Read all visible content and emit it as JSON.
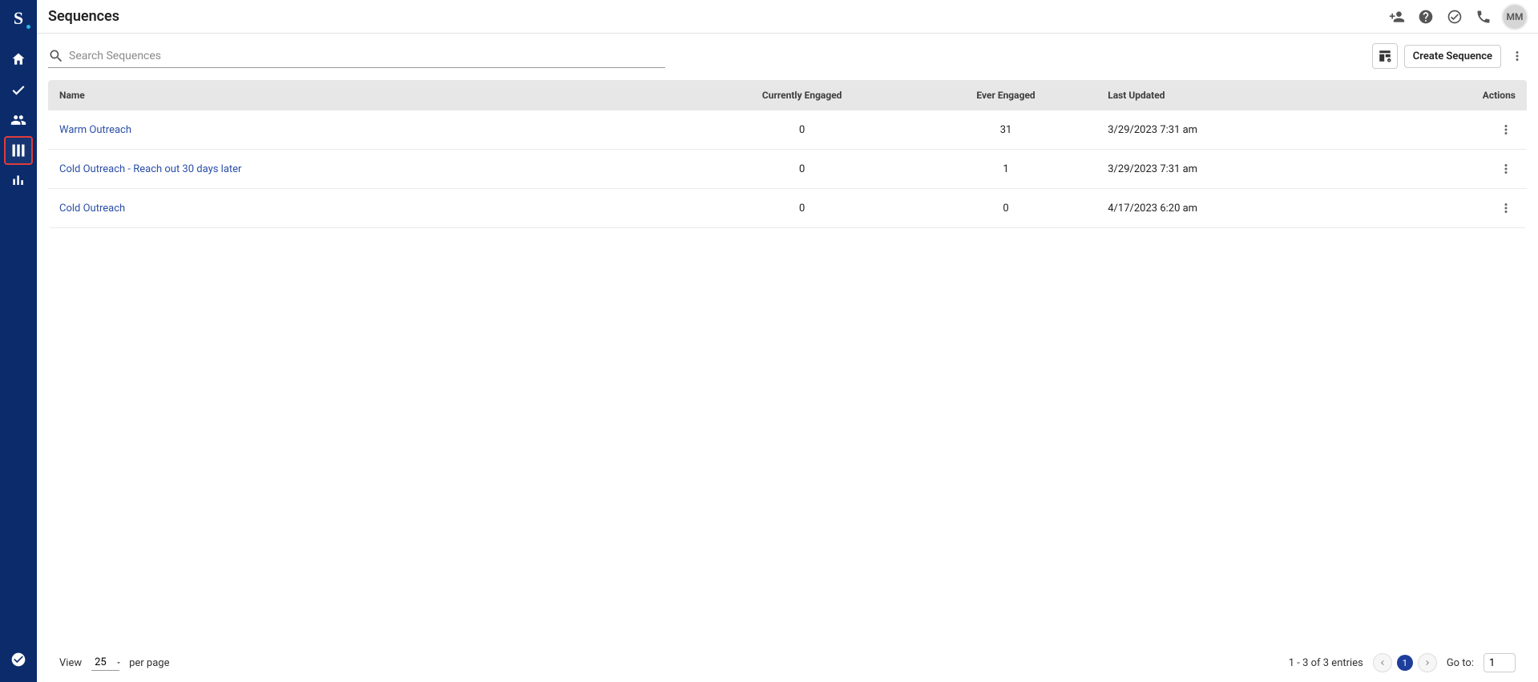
{
  "header": {
    "title": "Sequences",
    "avatar_initials": "MM"
  },
  "sidebar": {
    "logo_text": "S",
    "logo_dot": "."
  },
  "toolbar": {
    "search_placeholder": "Search Sequences",
    "create_label": "Create Sequence"
  },
  "table": {
    "columns": {
      "name": "Name",
      "currently_engaged": "Currently Engaged",
      "ever_engaged": "Ever Engaged",
      "last_updated": "Last Updated",
      "actions": "Actions"
    },
    "rows": [
      {
        "name": "Warm Outreach",
        "currently_engaged": "0",
        "ever_engaged": "31",
        "last_updated": "3/29/2023 7:31 am"
      },
      {
        "name": "Cold Outreach - Reach out 30 days later",
        "currently_engaged": "0",
        "ever_engaged": "1",
        "last_updated": "3/29/2023 7:31 am"
      },
      {
        "name": "Cold Outreach",
        "currently_engaged": "0",
        "ever_engaged": "0",
        "last_updated": "4/17/2023 6:20 am"
      }
    ]
  },
  "footer": {
    "view_label": "View",
    "per_page_label": "per page",
    "page_size_value": "25",
    "entries_summary": "1 - 3 of 3 entries",
    "current_page": "1",
    "goto_label": "Go to:",
    "goto_value": "1"
  }
}
